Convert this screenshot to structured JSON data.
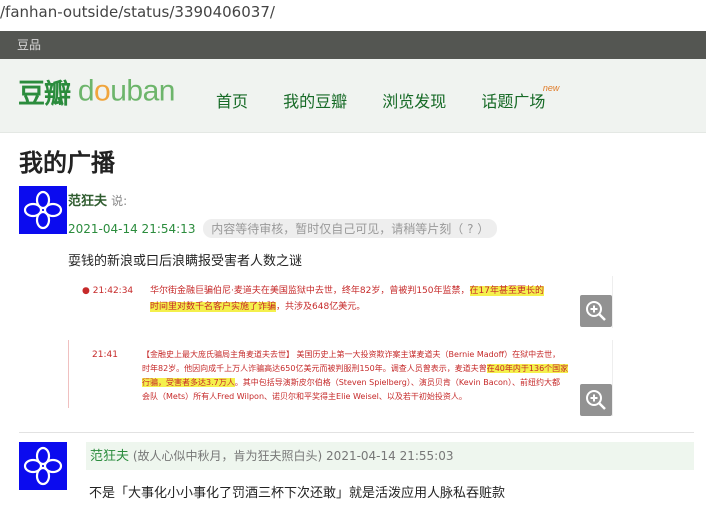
{
  "browser": {
    "url": "/fanhan-outside/status/3390406037/"
  },
  "global_nav": {
    "label": "豆品"
  },
  "site_nav": {
    "logo_cn": "豆瓣",
    "logo_en": "douban",
    "links": [
      "首页",
      "我的豆瓣",
      "浏览发现",
      "话题广场"
    ],
    "new_badge": "new"
  },
  "page": {
    "title": "我的广播"
  },
  "status1": {
    "author": "范狂夫",
    "said": "说:",
    "timestamp": "2021-04-14 21:54:13",
    "pending_notice": "内容等待审核，暂时仅自己可见，请稍等片刻（ ? ）",
    "text": "耍钱的新浪或曰后浪瞒报受害者人数之谜",
    "image1": {
      "time": "21:42:34",
      "line1_plain": "华尔街金融巨骗伯尼·麦道夫在美国监狱中去世，终年82岁，曾被判150年监禁，",
      "line1_highlight": "在17年甚至更长的",
      "line2_highlight": "时间里对数千名客户实施了诈骗",
      "line2_plain": "，共涉及648亿美元。"
    },
    "image2": {
      "time": "21:41",
      "line1": "【金融史上最大庞氏骗局主角麦道夫去世】 美国历史上第一大投资欺诈案主谋麦道夫（Bernie Madoff）在狱中去世，",
      "line2_plain": "时年82岁。他因向成千上万人诈骗高达650亿美元而被判服刑150年。调查人员曾表示，麦道夫曾",
      "line2_highlight": "在40年内于136个国家",
      "line3_highlight": "行骗，受害者多达3.7万人",
      "line3_plain": "。其中包括导演斯皮尔伯格（Steven Spielberg）、演员贝肯（Kevin Bacon）、前纽约大都",
      "line4": "会队（Mets）所有人Fred Wilpon、诺贝尔和平奖得主Elie Weisel、以及若干初始投资人。"
    }
  },
  "status2": {
    "author": "范狂夫",
    "quote": "(故人心似中秋月，肯为狂夫照白头)",
    "timestamp": "2021-04-14 21:55:03",
    "text": "不是「大事化小小事化了罚酒三杯下次还敢」就是活泼应用人脉私吞赃款"
  },
  "colors": {
    "brand_green": "#2b8c3d",
    "avatar_blue": "#0b0bef",
    "highlight": "#f4f04c"
  }
}
